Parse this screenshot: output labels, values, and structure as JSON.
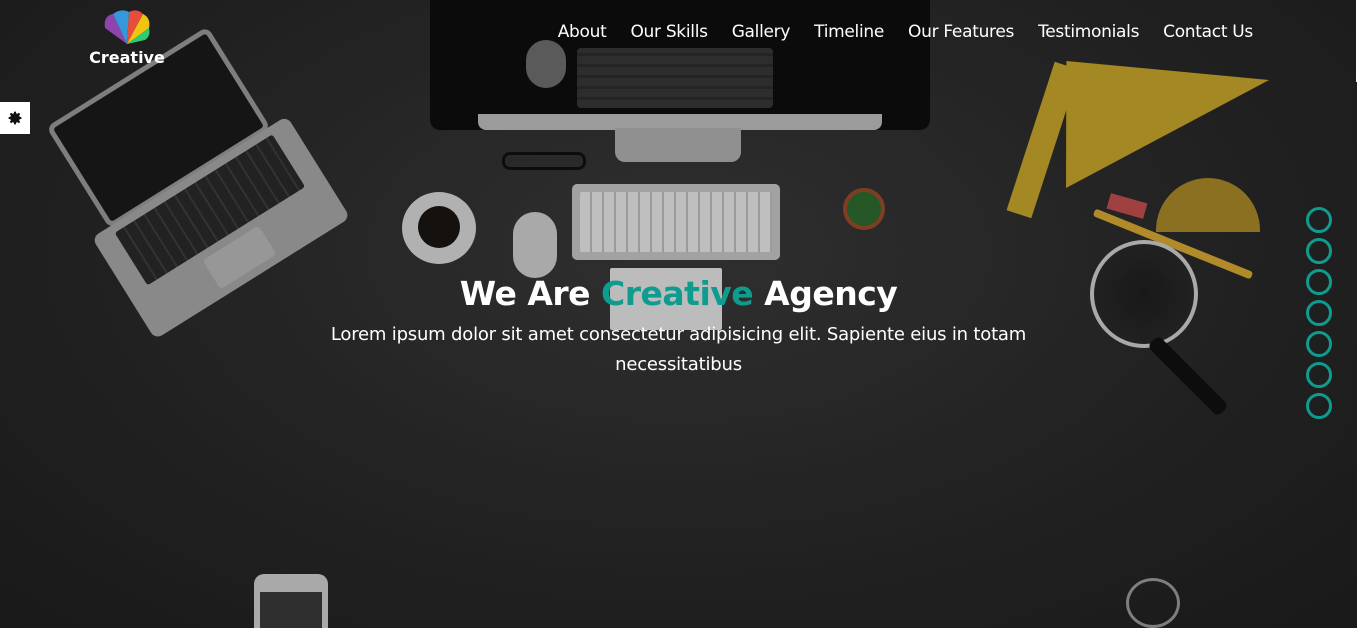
{
  "brand": {
    "name": "Creative",
    "icon": "fan-logo-icon",
    "colors": [
      "#8e44ad",
      "#3498db",
      "#e74c3c",
      "#f1c40f",
      "#2ecc71"
    ]
  },
  "nav": {
    "items": [
      "About",
      "Our Skills",
      "Gallery",
      "Timeline",
      "Our Features",
      "Testimonials",
      "Contact Us"
    ]
  },
  "settings": {
    "icon": "gear-icon"
  },
  "hero": {
    "headline_prefix": "We Are",
    "headline_accent": "Creative",
    "headline_suffix": "Agency",
    "subtitle": "Lorem ipsum dolor sit amet consectetur adipisicing elit. Sapiente eius in totam necessitatibus"
  },
  "bullets": {
    "count": 7
  },
  "colors": {
    "accent": "#0e9c8f",
    "text": "#ffffff",
    "background": "#2b2b2b"
  }
}
